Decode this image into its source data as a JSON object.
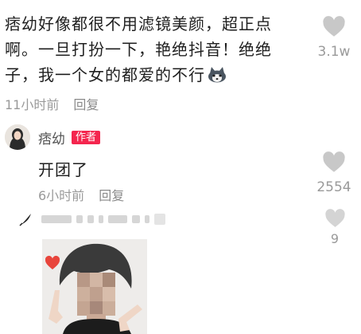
{
  "main_comment": {
    "text": "痞幼好像都很不用滤镜美颜，超正点啊。一旦打扮一下，艳绝抖音！绝绝子，我一个女的都爱的不行",
    "time": "11小时前",
    "reply_label": "回复",
    "likes": "3.1w",
    "emoji_icon": "husky-dog-emoji-icon"
  },
  "reply": {
    "author": "痞幼",
    "badge": "作者",
    "text": "开团了",
    "time": "6小时前",
    "reply_label": "回复",
    "likes": "2554"
  },
  "third_comment": {
    "likes": "9",
    "content": "blurred-photo"
  },
  "colors": {
    "heart": "#c8c8c8",
    "meta_text": "#9a9a9a",
    "badge_bg": "#f4254e",
    "photo_heart": "#e8453c"
  }
}
